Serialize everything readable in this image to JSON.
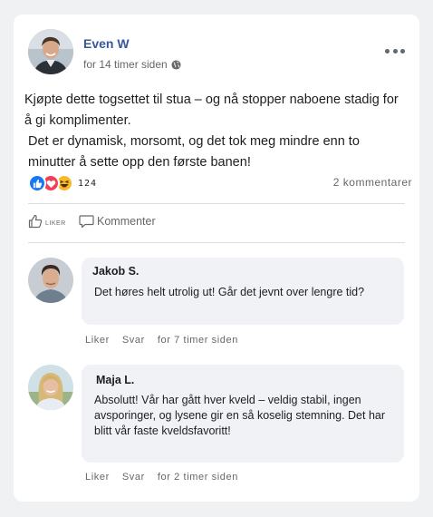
{
  "post": {
    "author": "Even W",
    "time": "for 14 timer siden",
    "text_line1": "Kjøpte dette togsettet til stua – og nå stopper naboene stadig for å gi komplimenter.",
    "text_line2": "Det er dynamisk, morsomt, og det tok meg mindre enn to minutter å sette opp den første banen!",
    "reaction_count": "124",
    "comment_count": "2 kommentarer"
  },
  "actions": {
    "like_label": "Liker",
    "comment_label": "Kommenter"
  },
  "comments": [
    {
      "name": "Jakob S.",
      "text": "Det høres helt utrolig ut! Går det jevnt over lengre tid?",
      "like": "Liker",
      "reply": "Svar",
      "time": "for 7 timer siden"
    },
    {
      "name": "Maja L.",
      "text": "Absolutt! Vår har gått hver kveld – veldig stabil, ingen avsporinger, og lysene gir en så koselig stemning. Det har blitt vår faste kveldsfavoritt!",
      "like": "Liker",
      "reply": "Svar",
      "time": "for 2 timer siden"
    }
  ],
  "colors": {
    "author_link": "#385898",
    "like_blue": "#1877f2",
    "love_red": "#f33e58",
    "haha_yellow": "#f7b928",
    "bubble_bg": "#f0f2f5"
  },
  "icons": [
    "globe-icon",
    "more-icon",
    "like-reaction-icon",
    "love-reaction-icon",
    "haha-reaction-icon",
    "thumbs-up-icon",
    "comment-bubble-icon"
  ]
}
